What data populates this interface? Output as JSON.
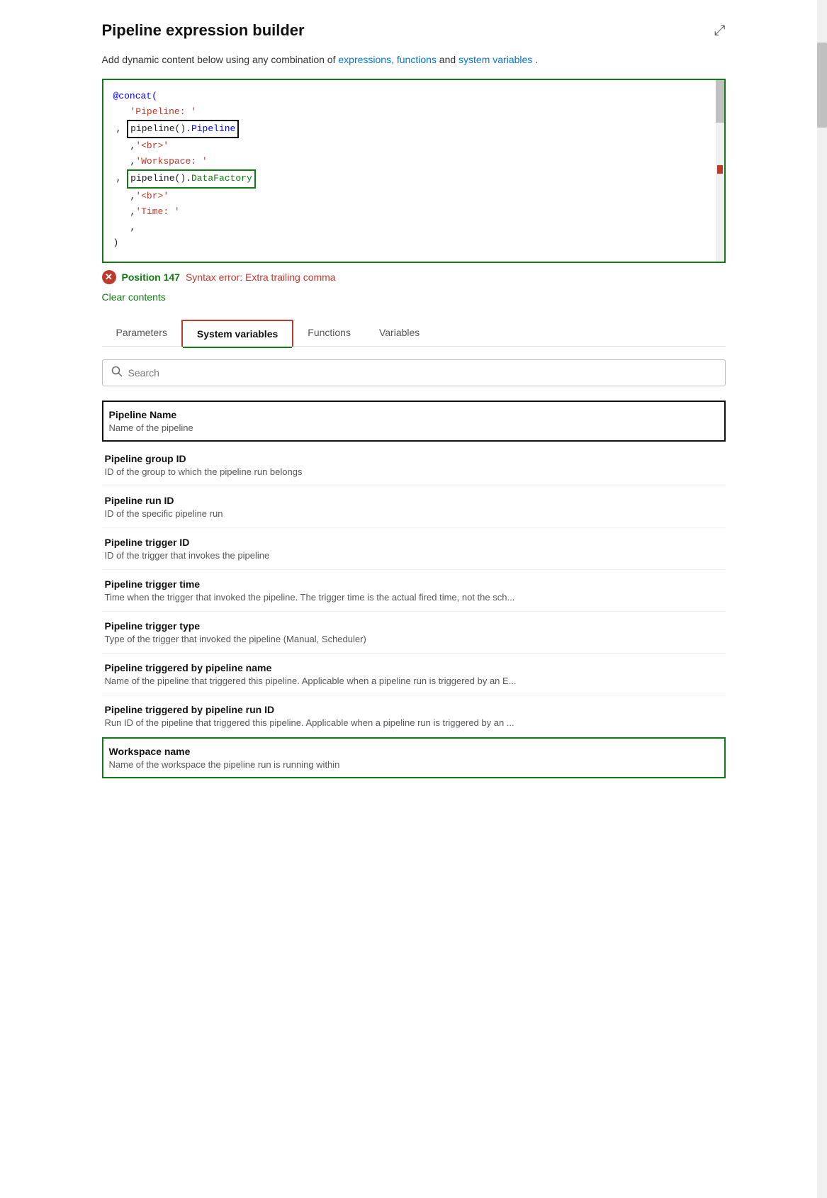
{
  "panel": {
    "title": "Pipeline expression builder",
    "expand_label": "⤢",
    "subtitle_text": "Add dynamic content below using any combination of ",
    "subtitle_link1": "expressions, functions",
    "subtitle_and": " and ",
    "subtitle_link2": "system variables",
    "subtitle_end": "."
  },
  "code_editor": {
    "lines": [
      "@concat(",
      "    'Pipeline: '",
      ",  pipeline().Pipeline",
      "    , '<br>'",
      "    , 'Workspace: '",
      ",  pipeline().DataFactory",
      "    , '<br>'",
      "    , 'Time: '",
      "    ,",
      ")"
    ]
  },
  "error": {
    "position_label": "Position 147",
    "message": "Syntax error: Extra trailing comma"
  },
  "clear_contents_label": "Clear contents",
  "tabs": [
    {
      "id": "parameters",
      "label": "Parameters",
      "active": false
    },
    {
      "id": "system_variables",
      "label": "System variables",
      "active": true
    },
    {
      "id": "functions",
      "label": "Functions",
      "active": false
    },
    {
      "id": "variables",
      "label": "Variables",
      "active": false
    }
  ],
  "search": {
    "placeholder": "Search"
  },
  "variables": [
    {
      "id": "pipeline_name",
      "name": "Pipeline Name",
      "description": "Name of the pipeline",
      "highlighted": "black"
    },
    {
      "id": "pipeline_group_id",
      "name": "Pipeline group ID",
      "description": "ID of the group to which the pipeline run belongs",
      "highlighted": ""
    },
    {
      "id": "pipeline_run_id",
      "name": "Pipeline run ID",
      "description": "ID of the specific pipeline run",
      "highlighted": ""
    },
    {
      "id": "pipeline_trigger_id",
      "name": "Pipeline trigger ID",
      "description": "ID of the trigger that invokes the pipeline",
      "highlighted": ""
    },
    {
      "id": "pipeline_trigger_time",
      "name": "Pipeline trigger time",
      "description": "Time when the trigger that invoked the pipeline. The trigger time is the actual fired time, not the sch...",
      "highlighted": ""
    },
    {
      "id": "pipeline_trigger_type",
      "name": "Pipeline trigger type",
      "description": "Type of the trigger that invoked the pipeline (Manual, Scheduler)",
      "highlighted": ""
    },
    {
      "id": "pipeline_triggered_by_name",
      "name": "Pipeline triggered by pipeline name",
      "description": "Name of the pipeline that triggered this pipeline. Applicable when a pipeline run is triggered by an E...",
      "highlighted": ""
    },
    {
      "id": "pipeline_triggered_by_run_id",
      "name": "Pipeline triggered by pipeline run ID",
      "description": "Run ID of the pipeline that triggered this pipeline. Applicable when a pipeline run is triggered by an ...",
      "highlighted": ""
    },
    {
      "id": "workspace_name",
      "name": "Workspace name",
      "description": "Name of the workspace the pipeline run is running within",
      "highlighted": "green"
    }
  ]
}
